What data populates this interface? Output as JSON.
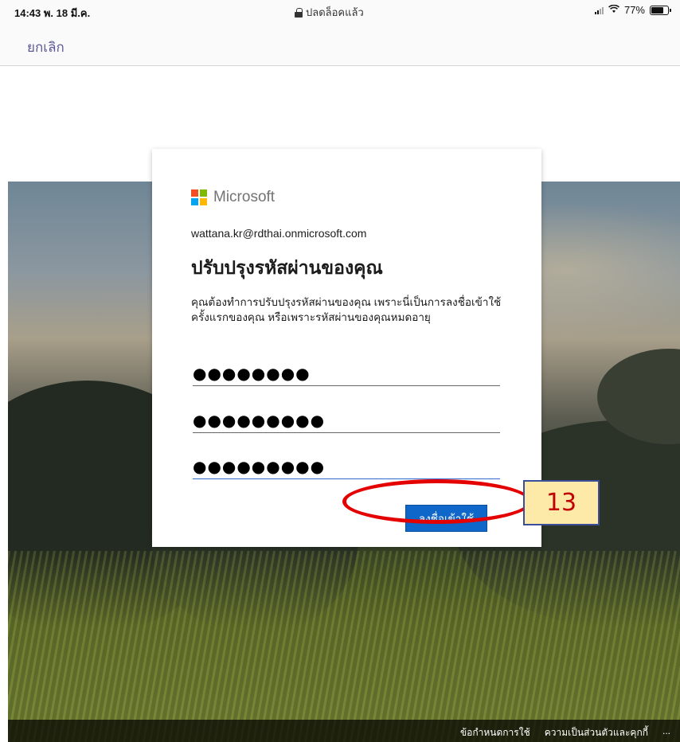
{
  "status_bar": {
    "time_date": "14:43  พ. 18 มี.ค.",
    "center_label": "ปลดล็อคแล้ว",
    "battery_level": 0.77,
    "battery_label": "77%"
  },
  "nav": {
    "cancel_label": "ยกเลิก"
  },
  "card": {
    "brand": "Microsoft",
    "email": "wattana.kr@rdthai.onmicrosoft.com",
    "title": "ปรับปรุงรหัสผ่านของคุณ",
    "description": "คุณต้องทำการปรับปรุงรหัสผ่านของคุณ เพราะนี่เป็นการลงชื่อเข้าใช้ครั้งแรกของคุณ หรือเพราะรหัสผ่านของคุณหมดอายุ",
    "fields": [
      {
        "value": "●●●●●●●●"
      },
      {
        "value": "●●●●●●●●●"
      },
      {
        "value": "●●●●●●●●●"
      }
    ],
    "signin_label": "ลงชื่อเข้าใช้"
  },
  "footer": {
    "terms_label": "ข้อกำหนดการใช้",
    "privacy_label": "ความเป็นส่วนตัวและคุกกี้",
    "more_label": "..."
  },
  "annotation": {
    "step_number": "13"
  },
  "colors": {
    "ms_red": "#f25022",
    "ms_green": "#7fba00",
    "ms_blue": "#00a4ef",
    "ms_yellow": "#ffb900",
    "signin_button": "#0f67c9",
    "highlight_ring": "#e50000",
    "step_badge": "#fde9a8"
  }
}
